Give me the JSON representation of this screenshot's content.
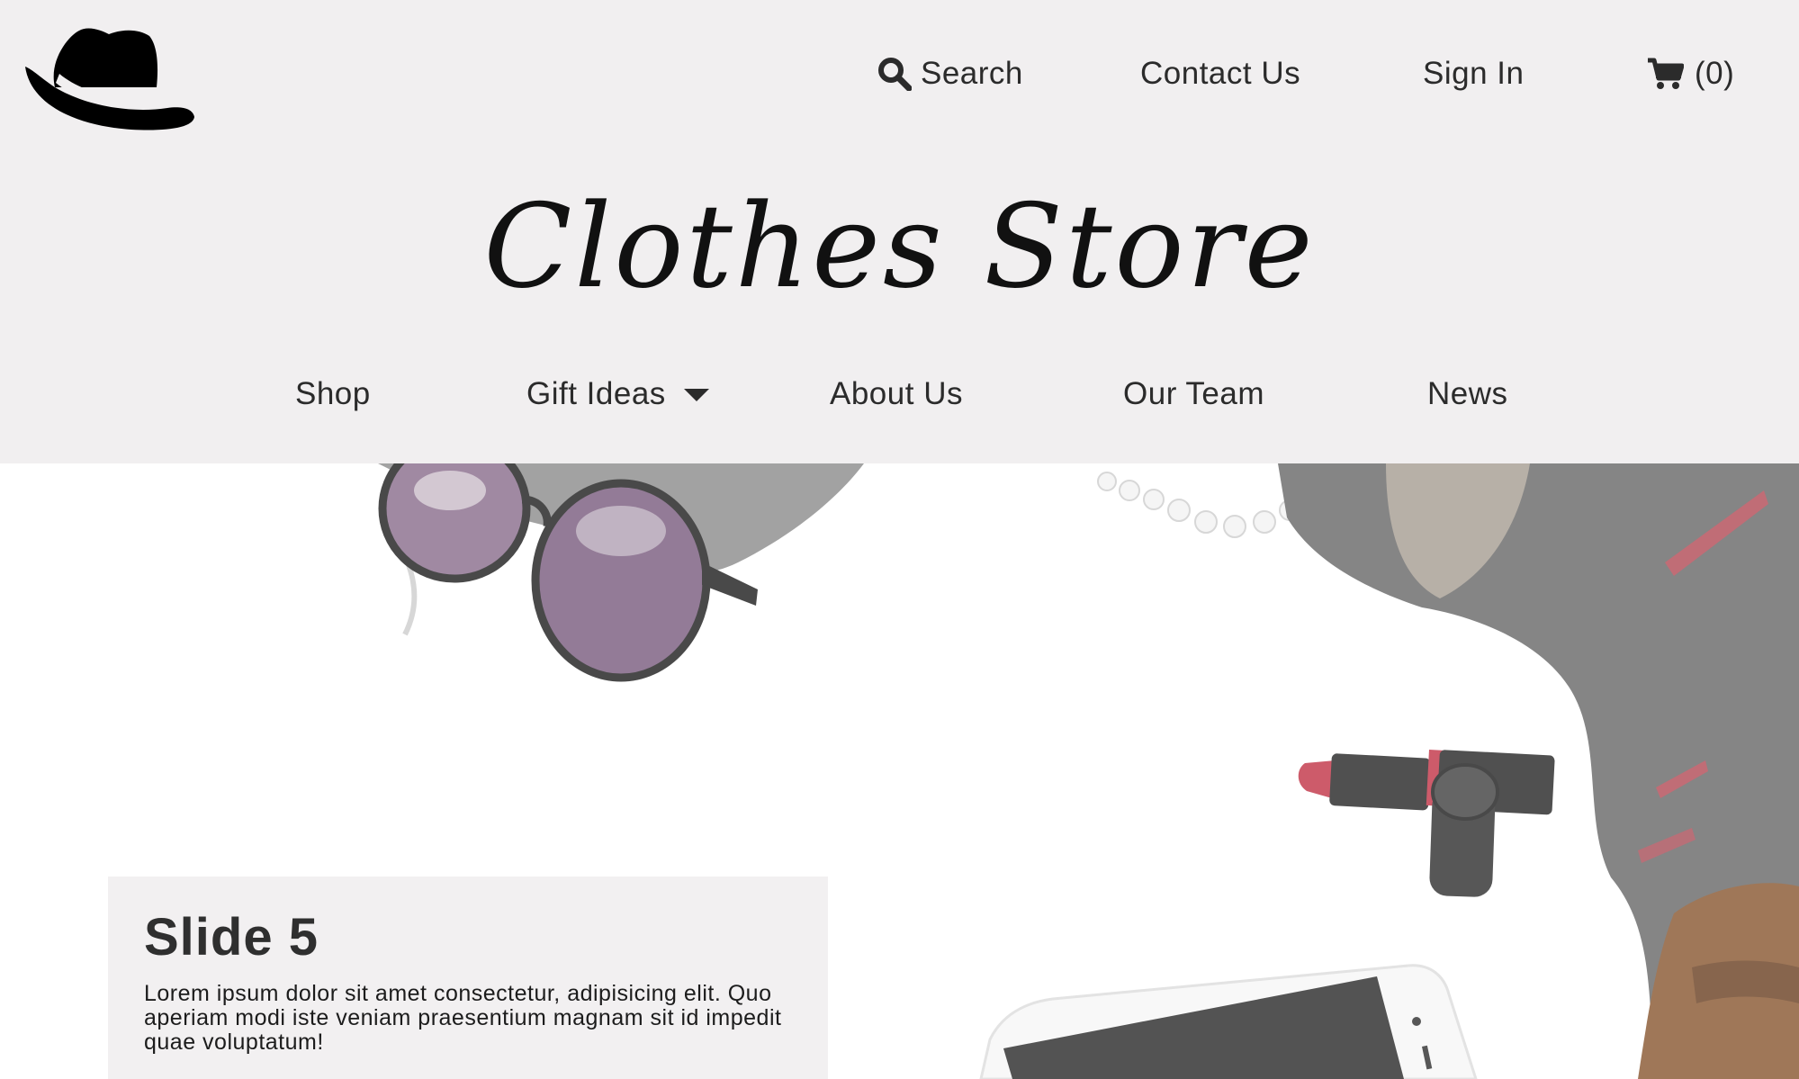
{
  "topnav": {
    "search_label": "Search",
    "contact_label": "Contact Us",
    "signin_label": "Sign In",
    "cart_count": "(0)"
  },
  "brand": {
    "title": "Clothes Store"
  },
  "mainnav": {
    "items": [
      "Shop",
      "Gift Ideas",
      "About Us",
      "Our Team",
      "News"
    ]
  },
  "slide": {
    "title": "Slide 5",
    "text": "Lorem ipsum dolor sit amet consectetur, adipisicing elit. Quo aperiam modi iste veniam praesentium magnam sit id impedit quae voluptatum!"
  },
  "icons": {
    "logo": "hat-icon",
    "search": "search-icon",
    "cart": "cart-icon",
    "dropdown": "caret-down-icon"
  }
}
